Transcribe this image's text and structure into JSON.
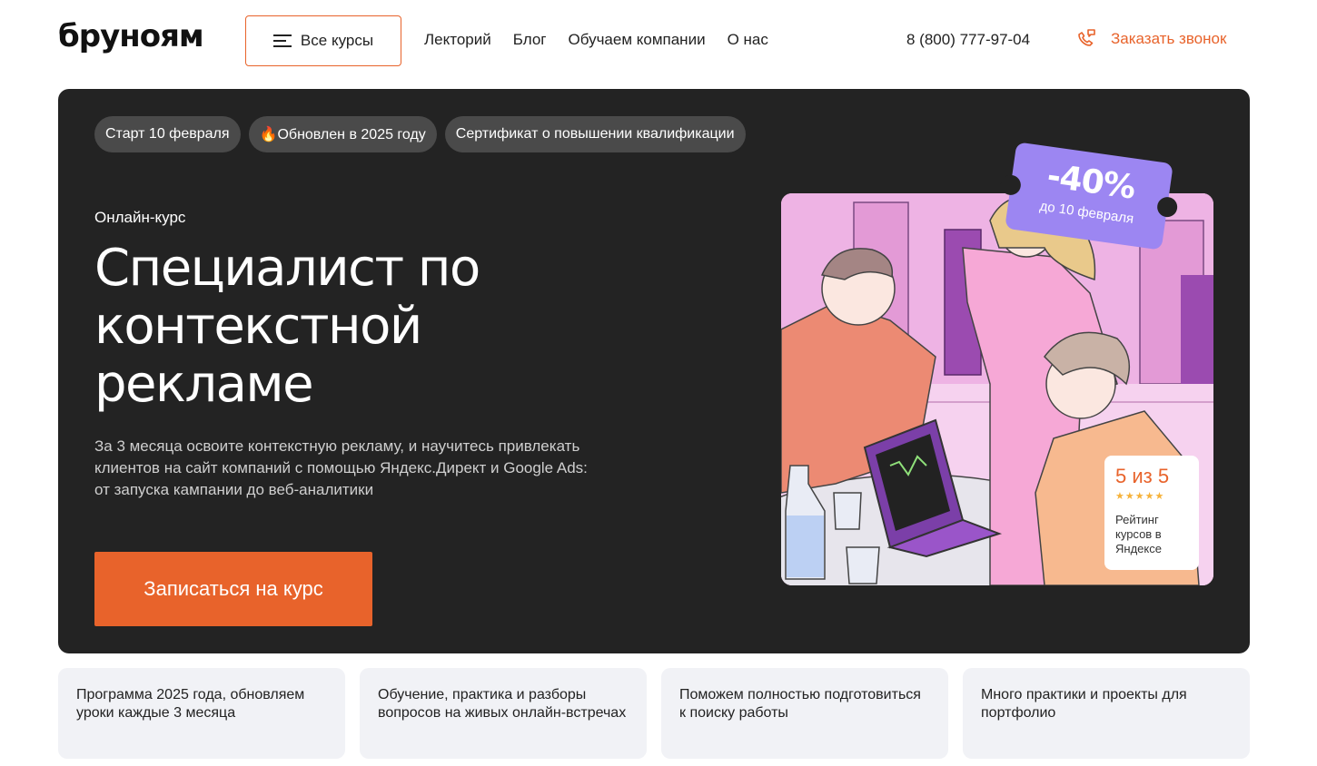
{
  "header": {
    "logo": "бруноям",
    "all_courses_label": "Все курсы",
    "nav": [
      "Лекторий",
      "Блог",
      "Обучаем компании",
      "О нас"
    ],
    "phone": "8 (800) 777-97-04",
    "callback_label": "Заказать звонок"
  },
  "hero": {
    "tags": [
      "Старт 10 февраля",
      "🔥Обновлен в 2025 году",
      "Сертификат о повышении квалификации"
    ],
    "kicker": "Онлайн-курс",
    "title_lines": [
      "Специалист по",
      "контекстной",
      "рекламе"
    ],
    "description": "За 3 месяца освоите контекстную рекламу, и научитесь привлекать клиентов на сайт компаний с помощью Яндекс.Директ и Google Ads: от запуска кампании до веб-аналитики",
    "cta_label": "Записаться на курс",
    "discount": {
      "value": "-40%",
      "until": "до 10 февраля"
    },
    "rating": {
      "score": "5 из 5",
      "stars": 5,
      "text": "Рейтинг курсов в Яндексе"
    }
  },
  "features": [
    "Программа 2025 года, обновляем уроки каждые 3 месяца",
    "Обучение, практика и разборы вопросов на живых онлайн-встречах",
    "Поможем полностью подготовиться к поиску работы",
    "Много практики и проекты для портфолио"
  ],
  "colors": {
    "accent": "#e8632b",
    "hero_bg": "#232323",
    "discount": "#9c86f2",
    "feature_bg": "#f1f2f6"
  },
  "icons": [
    "menu-icon",
    "phone-chat-icon",
    "star-icon"
  ]
}
